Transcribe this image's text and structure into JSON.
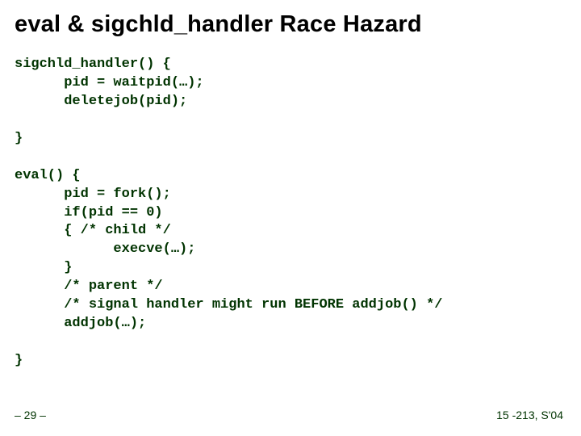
{
  "title": "eval & sigchld_handler Race Hazard",
  "code": "sigchld_handler() {\n      pid = waitpid(…);\n      deletejob(pid);\n\n}\n\neval() {\n      pid = fork();\n      if(pid == 0)\n      { /* child */\n            execve(…);\n      }\n      /* parent */\n      /* signal handler might run BEFORE addjob() */\n      addjob(…);\n\n}",
  "footer_left": "– 29 –",
  "footer_right": "15 -213, S'04"
}
